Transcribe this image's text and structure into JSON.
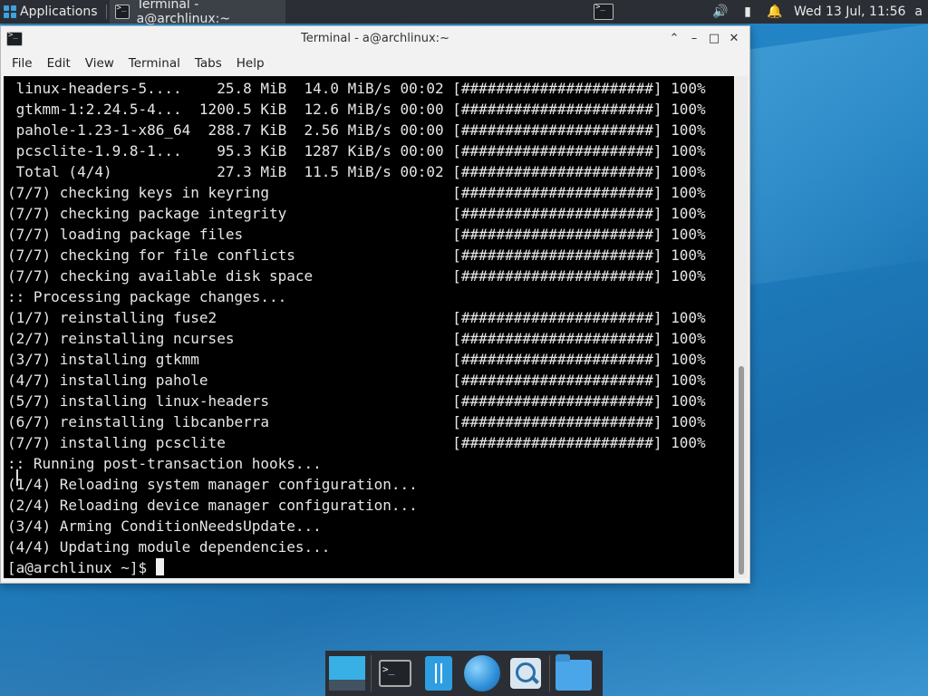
{
  "panel": {
    "applications_label": "Applications",
    "task_title": "Terminal - a@archlinux:~",
    "clock": "Wed 13 Jul, 11:56",
    "user": "a",
    "icons": [
      "volume-icon",
      "battery-icon",
      "notifications-icon"
    ]
  },
  "window": {
    "title": "Terminal - a@archlinux:~",
    "menu": [
      "File",
      "Edit",
      "View",
      "Terminal",
      "Tabs",
      "Help"
    ]
  },
  "terminal": {
    "lines": [
      " linux-headers-5....    25.8 MiB  14.0 MiB/s 00:02 [######################] 100%",
      " gtkmm-1:2.24.5-4...  1200.5 KiB  12.6 MiB/s 00:00 [######################] 100%",
      " pahole-1.23-1-x86_64  288.7 KiB  2.56 MiB/s 00:00 [######################] 100%",
      " pcsclite-1.9.8-1...    95.3 KiB  1287 KiB/s 00:00 [######################] 100%",
      " Total (4/4)            27.3 MiB  11.5 MiB/s 00:02 [######################] 100%",
      "(7/7) checking keys in keyring                     [######################] 100%",
      "(7/7) checking package integrity                   [######################] 100%",
      "(7/7) loading package files                        [######################] 100%",
      "(7/7) checking for file conflicts                  [######################] 100%",
      "(7/7) checking available disk space                [######################] 100%",
      ":: Processing package changes...",
      "(1/7) reinstalling fuse2                           [######################] 100%",
      "(2/7) reinstalling ncurses                         [######################] 100%",
      "(3/7) installing gtkmm                             [######################] 100%",
      "(4/7) installing pahole                            [######################] 100%",
      "(5/7) installing linux-headers                     [######################] 100%",
      "(6/7) reinstalling libcanberra                     [######################] 100%",
      "(7/7) installing pcsclite                          [######################] 100%",
      ":: Running post-transaction hooks...",
      "(1/4) Reloading system manager configuration...",
      "(2/4) Reloading device manager configuration...",
      "(3/4) Arming ConditionNeedsUpdate...",
      "(4/4) Updating module dependencies..."
    ],
    "prompt": "[a@archlinux ~]$ "
  },
  "dock": {
    "items": [
      "show-desktop-icon",
      "terminal-icon",
      "file-manager-icon",
      "web-browser-icon",
      "app-finder-icon",
      "home-folder-icon"
    ]
  }
}
